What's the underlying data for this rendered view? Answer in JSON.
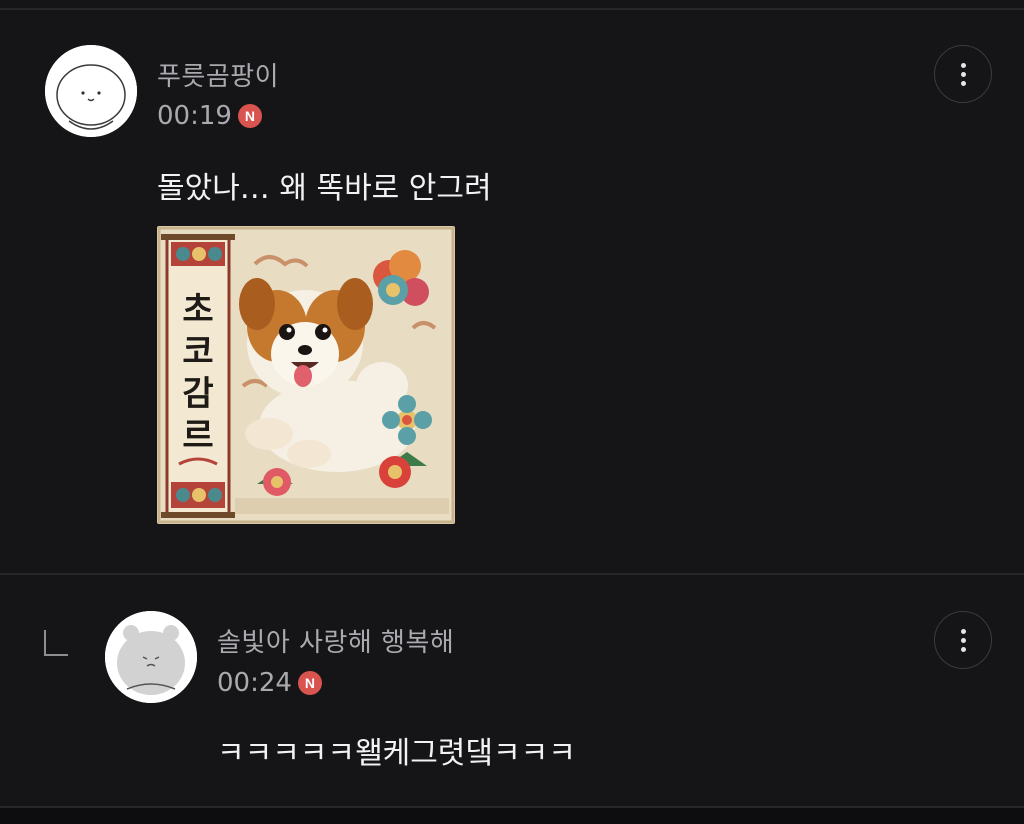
{
  "comments": [
    {
      "author": "푸릇곰팡이",
      "time": "00:19",
      "badge": "N",
      "text": "돌았나… 왜 똑바로 안그려",
      "image_icon": "puppy-folk-painting",
      "image_caption": "초코감르"
    },
    {
      "author": "솔빛아 사랑해 행복해",
      "time": "00:24",
      "badge": "N",
      "text": "ㅋㅋㅋㅋㅋ왤케그렷댘ㅋㅋㅋ"
    }
  ],
  "icons": {
    "more": "more-vertical-icon",
    "reply": "reply-arrow-icon"
  },
  "colors": {
    "background": "#151518",
    "text_primary": "#f2f2f2",
    "text_secondary": "#a9a9ae",
    "new_badge": "#d9534f"
  }
}
